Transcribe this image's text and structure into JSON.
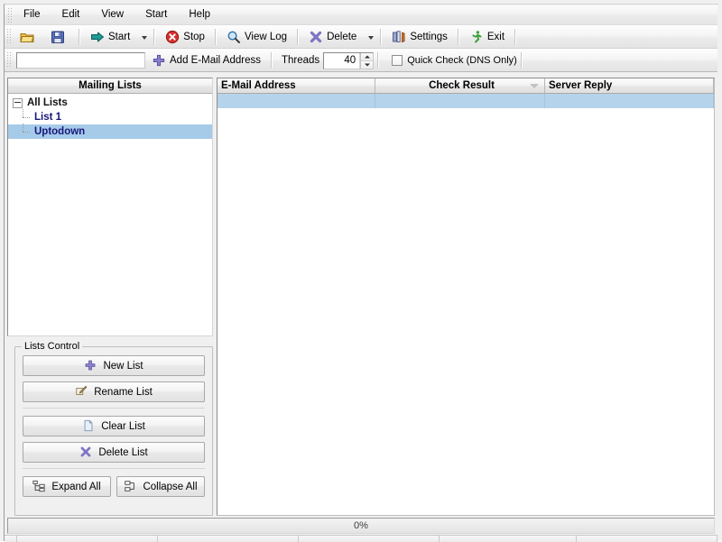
{
  "menubar": {
    "items": [
      {
        "label": "File"
      },
      {
        "label": "Edit"
      },
      {
        "label": "View"
      },
      {
        "label": "Start"
      },
      {
        "label": "Help"
      }
    ]
  },
  "toolbar": {
    "open_label": "",
    "save_label": "",
    "start_label": "Start",
    "stop_label": "Stop",
    "view_log_label": "View Log",
    "delete_label": "Delete",
    "settings_label": "Settings",
    "exit_label": "Exit"
  },
  "toolbar2": {
    "email_value": "",
    "email_placeholder": "",
    "add_email_label": "Add E-Mail Address",
    "threads_label": "Threads",
    "threads_value": "40",
    "quick_check_label": "Quick Check (DNS Only)",
    "quick_check_checked": false
  },
  "sidebar": {
    "header": "Mailing Lists",
    "tree": [
      {
        "label": "All Lists",
        "level": 0,
        "selected": false
      },
      {
        "label": "List 1",
        "level": 1,
        "selected": false
      },
      {
        "label": "Uptodown",
        "level": 1,
        "selected": true
      }
    ]
  },
  "lists_control": {
    "title": "Lists Control",
    "buttons": [
      {
        "label": "New List",
        "icon": "plus-icon"
      },
      {
        "label": "Rename List",
        "icon": "pencil-icon"
      },
      {
        "label": "Clear List",
        "icon": "document-icon"
      },
      {
        "label": "Delete List",
        "icon": "x-icon"
      },
      {
        "label": "Expand All",
        "icon": "expand-tree-icon"
      },
      {
        "label": "Collapse All",
        "icon": "collapse-tree-icon"
      }
    ]
  },
  "grid": {
    "columns": [
      {
        "label": "E-Mail Address",
        "width": 175,
        "align": "left",
        "sort": null
      },
      {
        "label": "Check Result",
        "width": 188,
        "align": "center",
        "sort": "desc"
      },
      {
        "label": "Server Reply",
        "width": 187,
        "align": "left",
        "sort": null
      }
    ],
    "rows": [
      {
        "email": "",
        "check_result": "",
        "server_reply": "",
        "selected": true
      }
    ]
  },
  "status": {
    "progress_text": "0%",
    "progress_percent": 0,
    "segments": [
      "",
      "",
      "",
      "",
      "",
      ""
    ]
  },
  "colors": {
    "selection": "#a6cbe9",
    "row_selection": "#b6d3ec",
    "tree_text": "#17177a",
    "chrome": "#f0f0f0"
  }
}
